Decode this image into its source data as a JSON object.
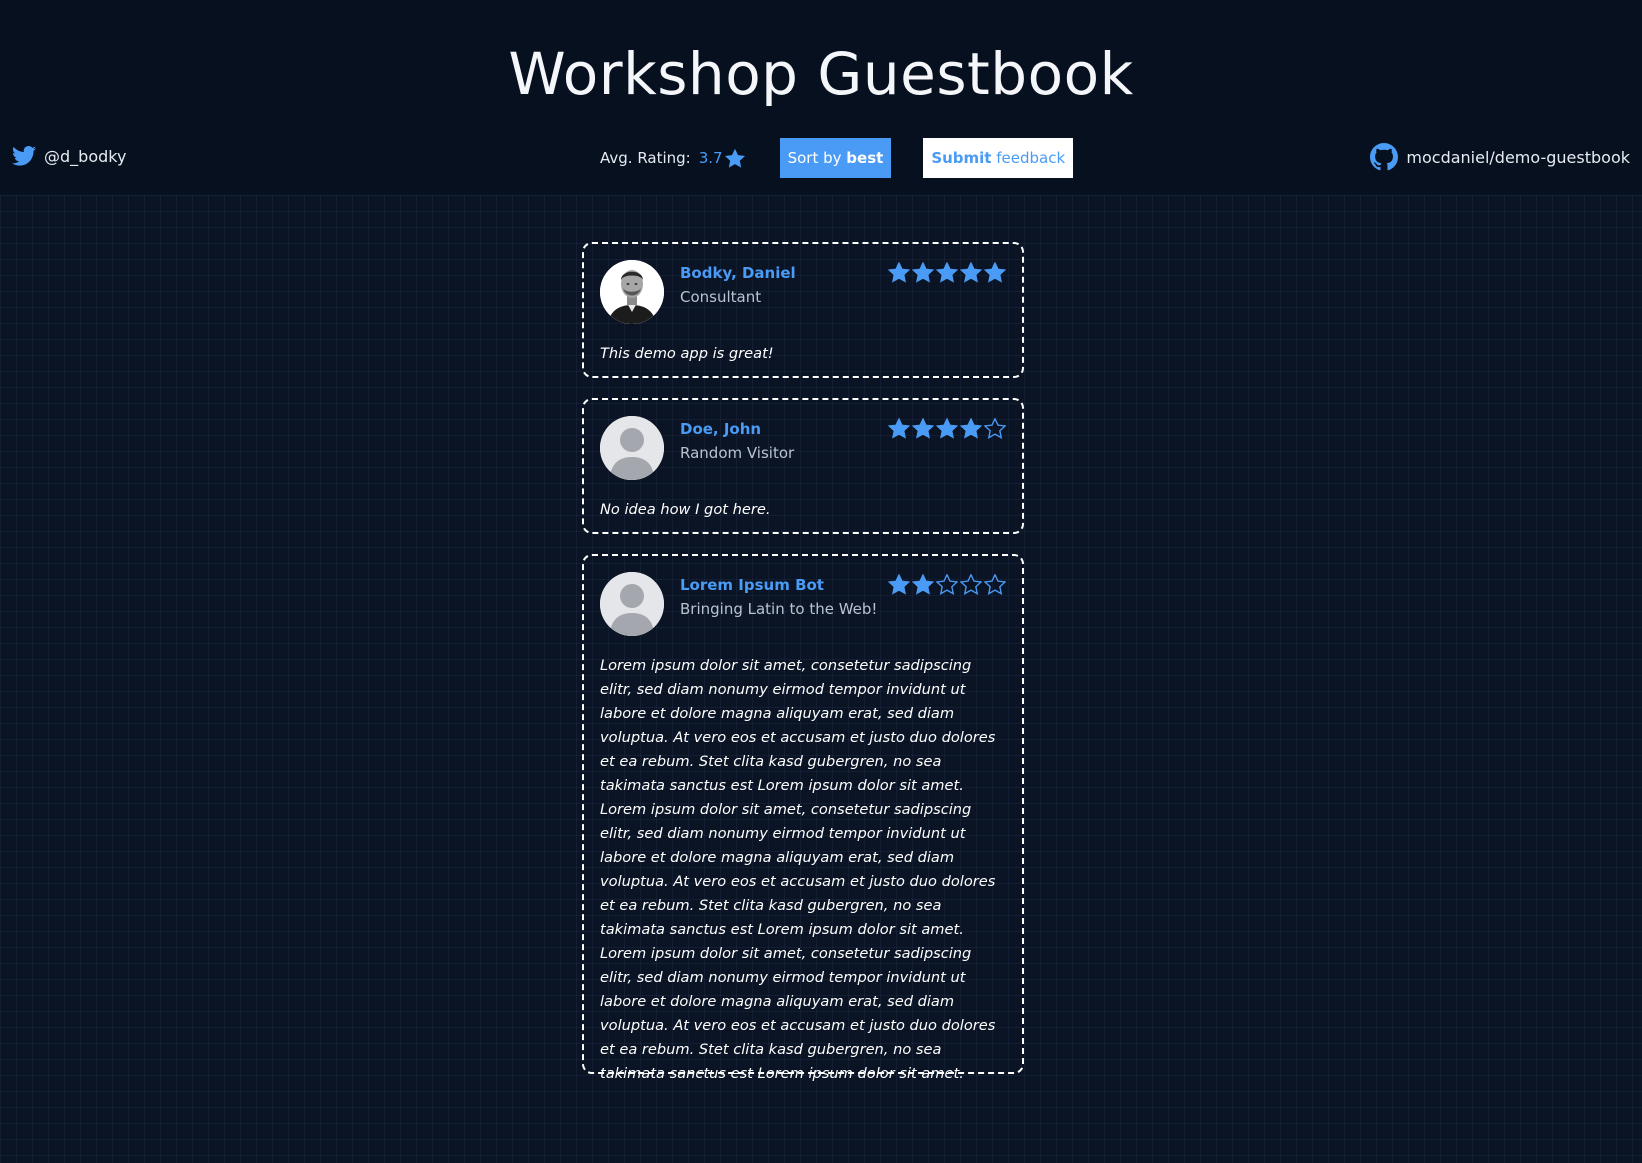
{
  "page": {
    "title": "Workshop Guestbook"
  },
  "toolbar": {
    "twitter_handle": "@d_bodky",
    "avg_label": "Avg. Rating:",
    "avg_value": "3.7",
    "avg_value_number": 3.7,
    "sort_prefix": "Sort by",
    "sort_bold": "best",
    "submit_bold": "Submit",
    "submit_rest": "feedback",
    "github_repo": "mocdaniel/demo-guestbook"
  },
  "colors": {
    "accent": "#4a9bf5",
    "background": "#07101f",
    "card_border": "#ffffff"
  },
  "icons": {
    "twitter": "twitter-icon",
    "github": "github-icon",
    "star_filled": "star-filled-icon",
    "star_empty": "star-empty-icon"
  },
  "entries": [
    {
      "name": "Bodky, Daniel",
      "role": "Consultant",
      "rating": 5,
      "comment": "This demo app is great!",
      "avatar": "photo"
    },
    {
      "name": "Doe, John",
      "role": "Random Visitor",
      "rating": 4,
      "comment": "No idea how I got here.",
      "avatar": "placeholder"
    },
    {
      "name": "Lorem Ipsum Bot",
      "role": "Bringing Latin to the Web!",
      "rating": 2,
      "comment": "Lorem ipsum dolor sit amet, consetetur sadipscing elitr, sed diam nonumy eirmod tempor invidunt ut labore et dolore magna aliquyam erat, sed diam voluptua. At vero eos et accusam et justo duo dolores et ea rebum. Stet clita kasd gubergren, no sea takimata sanctus est Lorem ipsum dolor sit amet. Lorem ipsum dolor sit amet, consetetur sadipscing elitr, sed diam nonumy eirmod tempor invidunt ut labore et dolore magna aliquyam erat, sed diam voluptua. At vero eos et accusam et justo duo dolores et ea rebum. Stet clita kasd gubergren, no sea takimata sanctus est Lorem ipsum dolor sit amet. Lorem ipsum dolor sit amet, consetetur sadipscing elitr, sed diam nonumy eirmod tempor invidunt ut labore et dolore magna aliquyam erat, sed diam voluptua. At vero eos et accusam et justo duo dolores et ea rebum. Stet clita kasd gubergren, no sea takimata sanctus est Lorem ipsum dolor sit amet.",
      "avatar": "placeholder"
    }
  ]
}
